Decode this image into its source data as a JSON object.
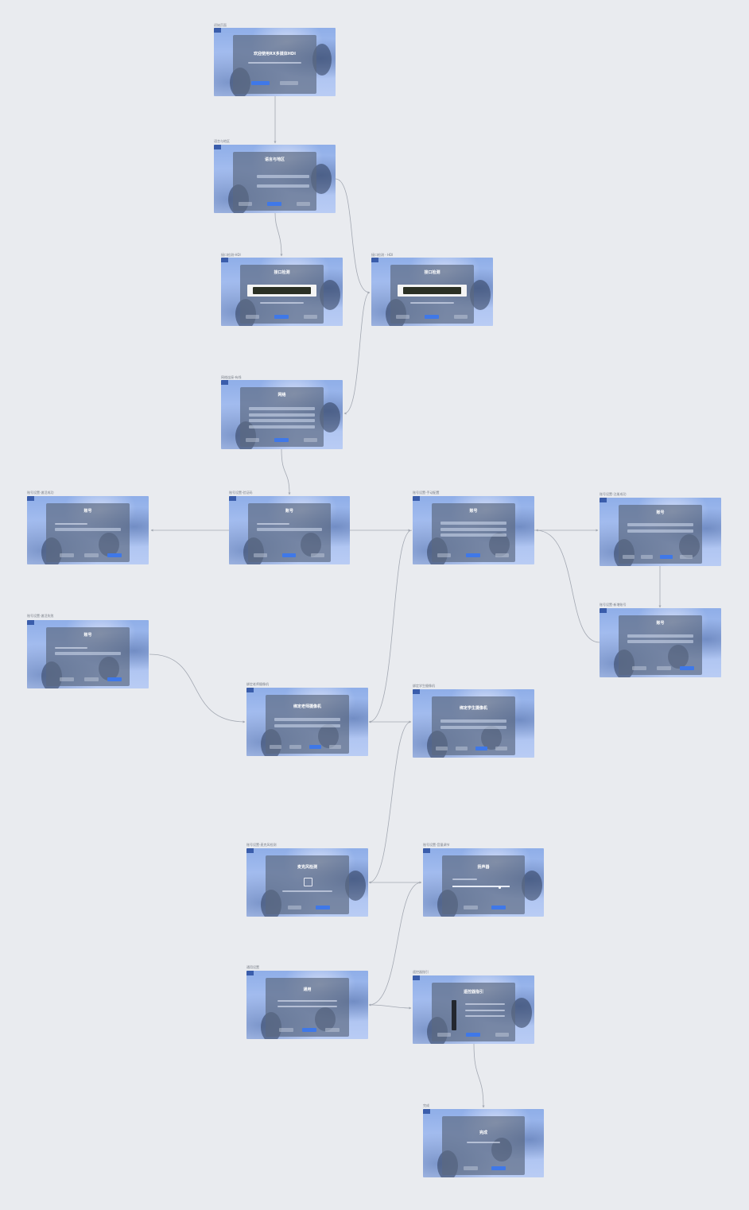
{
  "frames": [
    {
      "label": "初始页面",
      "title": "欢迎使用RX多媒体HDI"
    },
    {
      "label": "语言与地区",
      "title": "语言与地区"
    },
    {
      "label": "接口检测-HDI",
      "title": "接口检测"
    },
    {
      "label": "接口检测 - HDI",
      "title": "接口检测"
    },
    {
      "label": "网络连接-有线",
      "title": "网络"
    },
    {
      "label": "账号设置-验证码",
      "title": "账号"
    },
    {
      "label": "账号设置-激活成功",
      "title": "账号"
    },
    {
      "label": "账号设置-手动配置",
      "title": "账号"
    },
    {
      "label": "账号设置-注册成功",
      "title": "账号"
    },
    {
      "label": "账号设置-激活失败",
      "title": "账号"
    },
    {
      "label": "账号设置-新增账号",
      "title": "账号"
    },
    {
      "label": "绑定老师摄像机",
      "title": "绑定老师摄像机"
    },
    {
      "label": "绑定学生摄像机",
      "title": "绑定学生摄像机"
    },
    {
      "label": "账号设置-麦克风检测",
      "title": "麦克风检测"
    },
    {
      "label": "账号设置-音量调节",
      "title": "扬声器"
    },
    {
      "label": "通用设置",
      "title": "通用"
    },
    {
      "label": "遥控器指引",
      "title": "遥控器指引"
    },
    {
      "label": "完成",
      "title": "完成"
    }
  ],
  "connector_color": "#a3a8b2"
}
